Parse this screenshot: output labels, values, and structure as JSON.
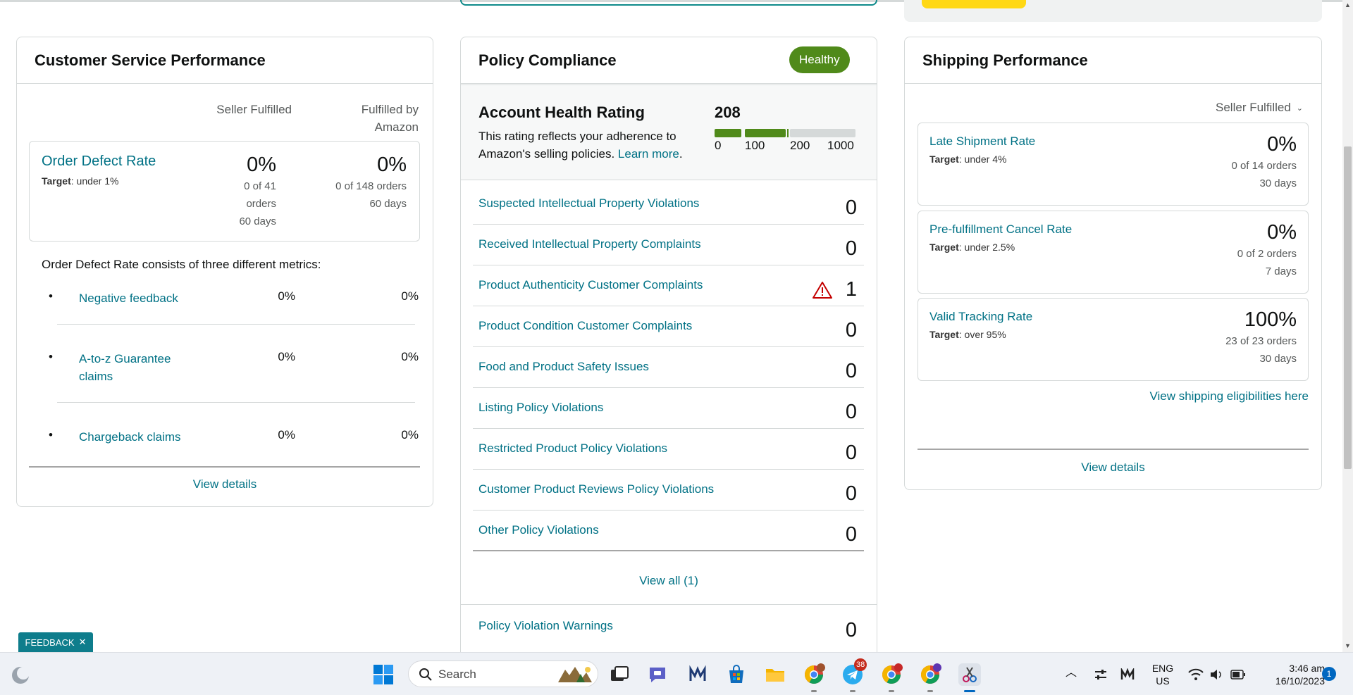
{
  "customer_service": {
    "title": "Customer Service Performance",
    "col_seller": "Seller Fulfilled",
    "col_fba_line1": "Fulfilled by",
    "col_fba_line2": "Amazon",
    "odr": {
      "title": "Order Defect Rate",
      "target_label": "Target",
      "target_value": ": under 1%",
      "seller_pct": "0%",
      "seller_sub1": "0 of 41",
      "seller_sub2": "orders",
      "seller_sub3": "60 days",
      "fba_pct": "0%",
      "fba_sub1": "0 of 148 orders",
      "fba_sub2": "60 days"
    },
    "description": "Order Defect Rate consists of three different metrics:",
    "metrics": [
      {
        "label": "Negative feedback",
        "seller": "0%",
        "fba": "0%"
      },
      {
        "label": "A-to-z Guarantee claims",
        "seller": "0%",
        "fba": "0%"
      },
      {
        "label": "Chargeback claims",
        "seller": "0%",
        "fba": "0%"
      }
    ],
    "view_details": "View details"
  },
  "policy": {
    "title": "Policy Compliance",
    "badge": "Healthy",
    "ahr_title": "Account Health Rating",
    "ahr_desc": "This rating reflects your adherence to Amazon's selling policies.",
    "ahr_learn_more": "Learn more",
    "ahr_score": "208",
    "ahr_ticks": [
      "0",
      "100",
      "200",
      "1000"
    ],
    "rows": [
      {
        "label": "Suspected Intellectual Property Violations",
        "value": "0"
      },
      {
        "label": "Received Intellectual Property Complaints",
        "value": "0"
      },
      {
        "label": "Product Authenticity Customer Complaints",
        "value": "1"
      },
      {
        "label": "Product Condition Customer Complaints",
        "value": "0"
      },
      {
        "label": "Food and Product Safety Issues",
        "value": "0"
      },
      {
        "label": "Listing Policy Violations",
        "value": "0"
      },
      {
        "label": "Restricted Product Policy Violations",
        "value": "0"
      },
      {
        "label": "Customer Product Reviews Policy Violations",
        "value": "0"
      },
      {
        "label": "Other Policy Violations",
        "value": "0"
      }
    ],
    "view_all": "View all (1)",
    "warnings_label": "Policy Violation Warnings",
    "warnings_value": "0"
  },
  "shipping": {
    "title": "Shipping Performance",
    "dropdown": "Seller Fulfilled",
    "boxes": [
      {
        "title": "Late Shipment Rate",
        "target_label": "Target",
        "target_value": ": under 4%",
        "pct": "0%",
        "sub1": "0 of 14 orders",
        "sub2": "30 days"
      },
      {
        "title": "Pre-fulfillment Cancel Rate",
        "target_label": "Target",
        "target_value": ": under 2.5%",
        "pct": "0%",
        "sub1": "0 of 2 orders",
        "sub2": "7 days"
      },
      {
        "title": "Valid Tracking Rate",
        "target_label": "Target",
        "target_value": ": over 95%",
        "pct": "100%",
        "sub1": "23 of 23 orders",
        "sub2": "30 days"
      }
    ],
    "eligibility_link": "View shipping eligibilities here",
    "view_details": "View details"
  },
  "feedback": {
    "label": "FEEDBACK",
    "close": "✕"
  },
  "taskbar": {
    "search_placeholder": "Search",
    "telegram_badge": "38",
    "lang_line1": "ENG",
    "lang_line2": "US",
    "time": "3:46 am",
    "date": "16/10/2023",
    "notification_count": "1"
  },
  "colors": {
    "link": "#007185",
    "healthy": "#508a1a",
    "taskbar": "#eef1f6"
  }
}
